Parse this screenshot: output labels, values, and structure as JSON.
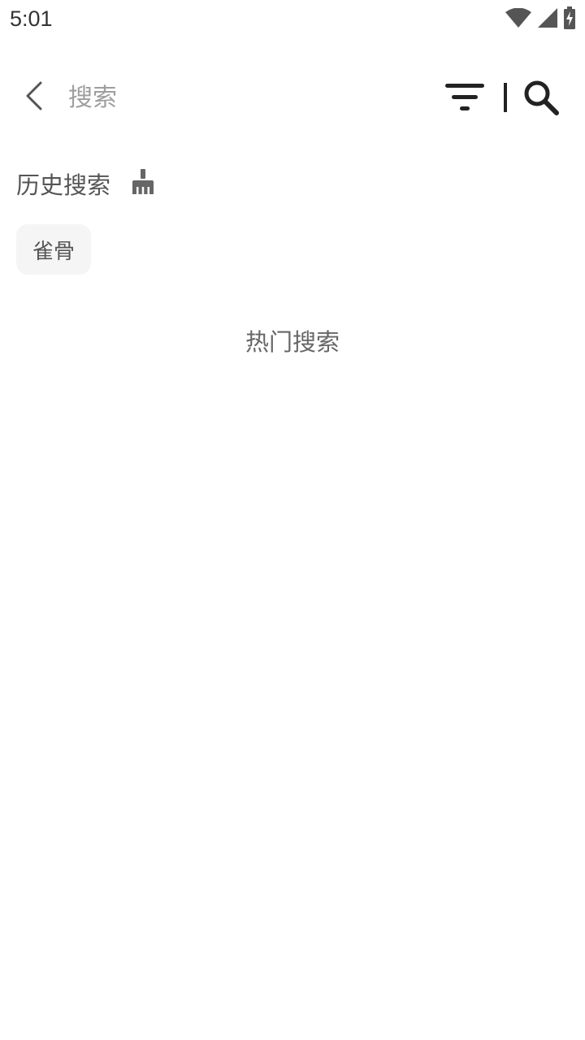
{
  "status_bar": {
    "time": "5:01",
    "icons": [
      "wifi-icon",
      "cellular-signal-icon",
      "battery-charging-icon"
    ]
  },
  "toolbar": {
    "back_icon": "chevron-left-icon",
    "search_placeholder": "搜索",
    "search_value": "",
    "filter_icon": "filter-icon",
    "search_icon": "magnifier-icon"
  },
  "history": {
    "title": "历史搜索",
    "clear_icon": "broom-icon",
    "tags": [
      {
        "label": "雀骨"
      }
    ]
  },
  "hot": {
    "title": "热门搜索"
  },
  "colors": {
    "background": "#ffffff",
    "tag_background": "#f5f5f5",
    "text": "#555555",
    "placeholder": "#9e9e9e",
    "icon": "#222222"
  }
}
